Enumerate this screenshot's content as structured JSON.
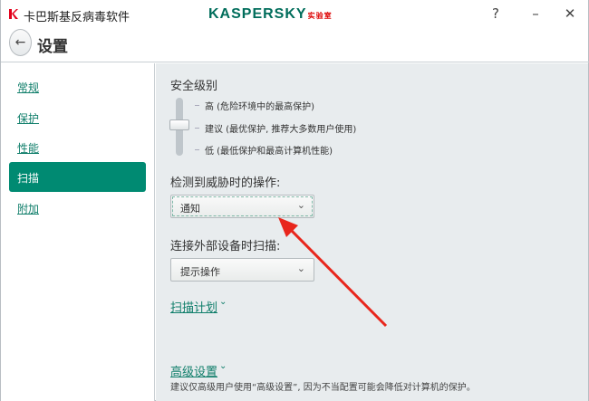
{
  "titlebar": {
    "app_title": "卡巴斯基反病毒软件",
    "logo": "KASPERSKY",
    "logo_suffix": "实验室",
    "help": "?",
    "minimize": "–",
    "close": "✕"
  },
  "header": {
    "back_icon": "←",
    "title": "设置"
  },
  "sidebar": {
    "items": [
      {
        "label": "常规"
      },
      {
        "label": "保护"
      },
      {
        "label": "性能"
      },
      {
        "label": "扫描"
      },
      {
        "label": "附加"
      }
    ],
    "active": "扫描"
  },
  "main": {
    "security_level": {
      "title": "安全级别",
      "levels": [
        "高 (危险环境中的最高保护)",
        "建议 (最优保护, 推荐大多数用户使用)",
        "低 (最低保护和最高计算机性能)"
      ],
      "selected": "建议"
    },
    "threat_action": {
      "label": "检测到威胁时的操作:",
      "value": "通知"
    },
    "external_device": {
      "label": "连接外部设备时扫描:",
      "value": "提示操作"
    },
    "scan_schedule": {
      "label": "扫描计划"
    },
    "advanced": {
      "label": "高级设置",
      "note": "建议仅高级用户使用“高级设置”, 因为不当配置可能会降低对计算机的保护。"
    },
    "chevron": "⌄"
  },
  "colors": {
    "accent": "#008a72",
    "link": "#0f7e6a",
    "annotation_arrow": "#e8261c"
  }
}
